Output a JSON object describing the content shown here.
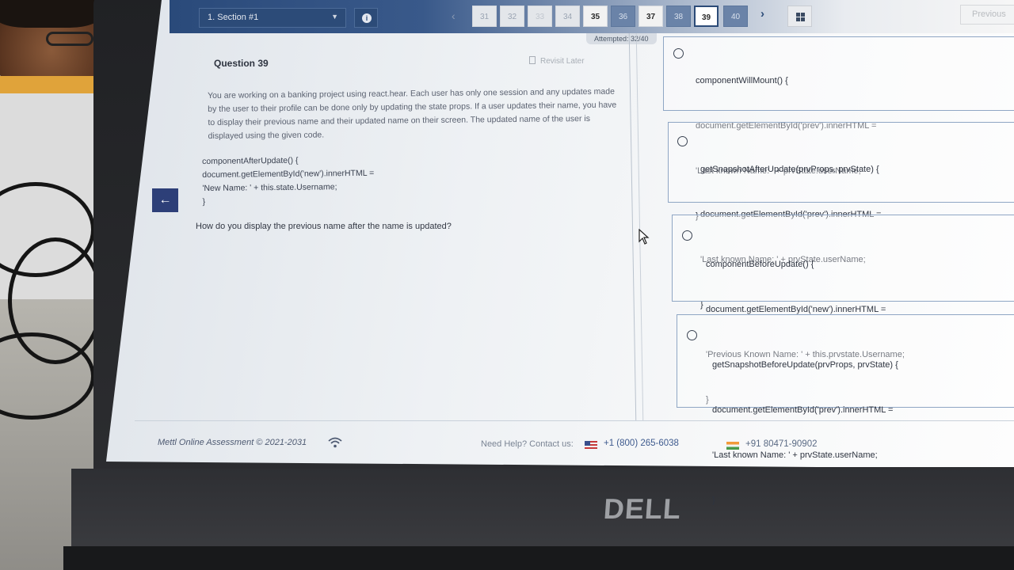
{
  "topbar": {
    "section": "1. Section #1",
    "question_numbers": [
      "31",
      "32",
      "33",
      "34",
      "35",
      "36",
      "37",
      "38",
      "39",
      "40"
    ],
    "current_question": "39",
    "previous_label": "Previous",
    "attempted": "Attempted: 32/40"
  },
  "question": {
    "title": "Question 39",
    "revisit_label": "Revisit Later",
    "paragraph": "You are working on a banking project using react.hear. Each user has only one session and any updates made by the user to their profile can be done only by updating the state props. If a user updates their name, you have to display their previous name and their updated name on their screen. The updated name of the user is displayed using the given code.",
    "code_lines": [
      "componentAfterUpdate() {",
      "document.getElementById('new').innerHTML =",
      "'New Name: ' + this.state.Username;",
      "}"
    ],
    "prompt": "How do you display the previous name after the name is updated?"
  },
  "options": [
    {
      "lines": [
        "componentWillMount() {",
        "document.getElementById('prev').innerHTML =",
        "'Last known Name: ' + prvState.userName;",
        "}"
      ]
    },
    {
      "lines": [
        "getSnapshotAfterUpdate(prvProps, prvState) {",
        "document.getElementById('prev').innerHTML =",
        "'Last known Name: ' + prvState.userName;",
        "}"
      ]
    },
    {
      "lines": [
        "componentBeforeUpdate() {",
        "document.getElementById('new').innerHTML =",
        "'Previous Known Name: ' + this.prvstate.Username;",
        "}"
      ]
    },
    {
      "lines": [
        "getSnapshotBeforeUpdate(prvProps, prvState) {",
        "document.getElementById('prev').innerHTML =",
        "'Last known Name: ' + prvState.userName;",
        "}"
      ]
    }
  ],
  "footer": {
    "copyright": "Mettl Online Assessment © 2021-2031",
    "help": "Need Help? Contact us:",
    "phone_us": "+1 (800) 265-6038",
    "phone_in": "+91 80471-90902"
  },
  "laptop": {
    "brand": "DELL"
  }
}
